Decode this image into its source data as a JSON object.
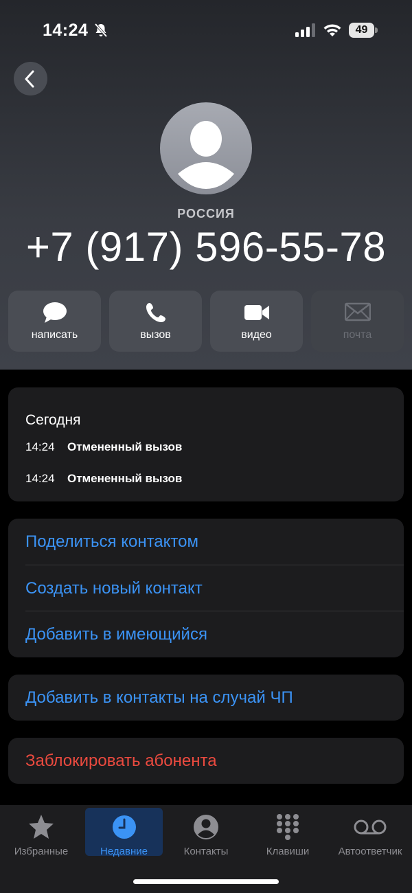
{
  "status_bar": {
    "time": "14:24",
    "battery": "49"
  },
  "contact": {
    "country": "РОССИЯ",
    "phone": "+7 (917) 596-55-78"
  },
  "actions": [
    {
      "label": "написать",
      "icon": "message-icon"
    },
    {
      "label": "вызов",
      "icon": "phone-icon"
    },
    {
      "label": "видео",
      "icon": "video-icon"
    },
    {
      "label": "почта",
      "icon": "mail-icon"
    }
  ],
  "calls": {
    "heading": "Сегодня",
    "items": [
      {
        "time": "14:24",
        "status": "Отмененный вызов"
      },
      {
        "time": "14:24",
        "status": "Отмененный вызов"
      }
    ]
  },
  "links": [
    {
      "label": "Поделиться контактом"
    },
    {
      "label": "Создать новый контакт"
    },
    {
      "label": "Добавить в имеющийся"
    }
  ],
  "emergency": {
    "label": "Добавить в контакты на случай ЧП"
  },
  "block": {
    "label": "Заблокировать абонента"
  },
  "tabbar": [
    {
      "label": "Избранные",
      "icon": "star-icon",
      "active": false
    },
    {
      "label": "Недавние",
      "icon": "clock-icon",
      "active": true
    },
    {
      "label": "Контакты",
      "icon": "contact-icon",
      "active": false
    },
    {
      "label": "Клавиши",
      "icon": "keypad-icon",
      "active": false
    },
    {
      "label": "Автоответчик",
      "icon": "voicemail-icon",
      "active": false
    }
  ],
  "colors": {
    "accent": "#3b93f5",
    "destructive": "#eb4a3f",
    "card": "#1c1c1e"
  }
}
